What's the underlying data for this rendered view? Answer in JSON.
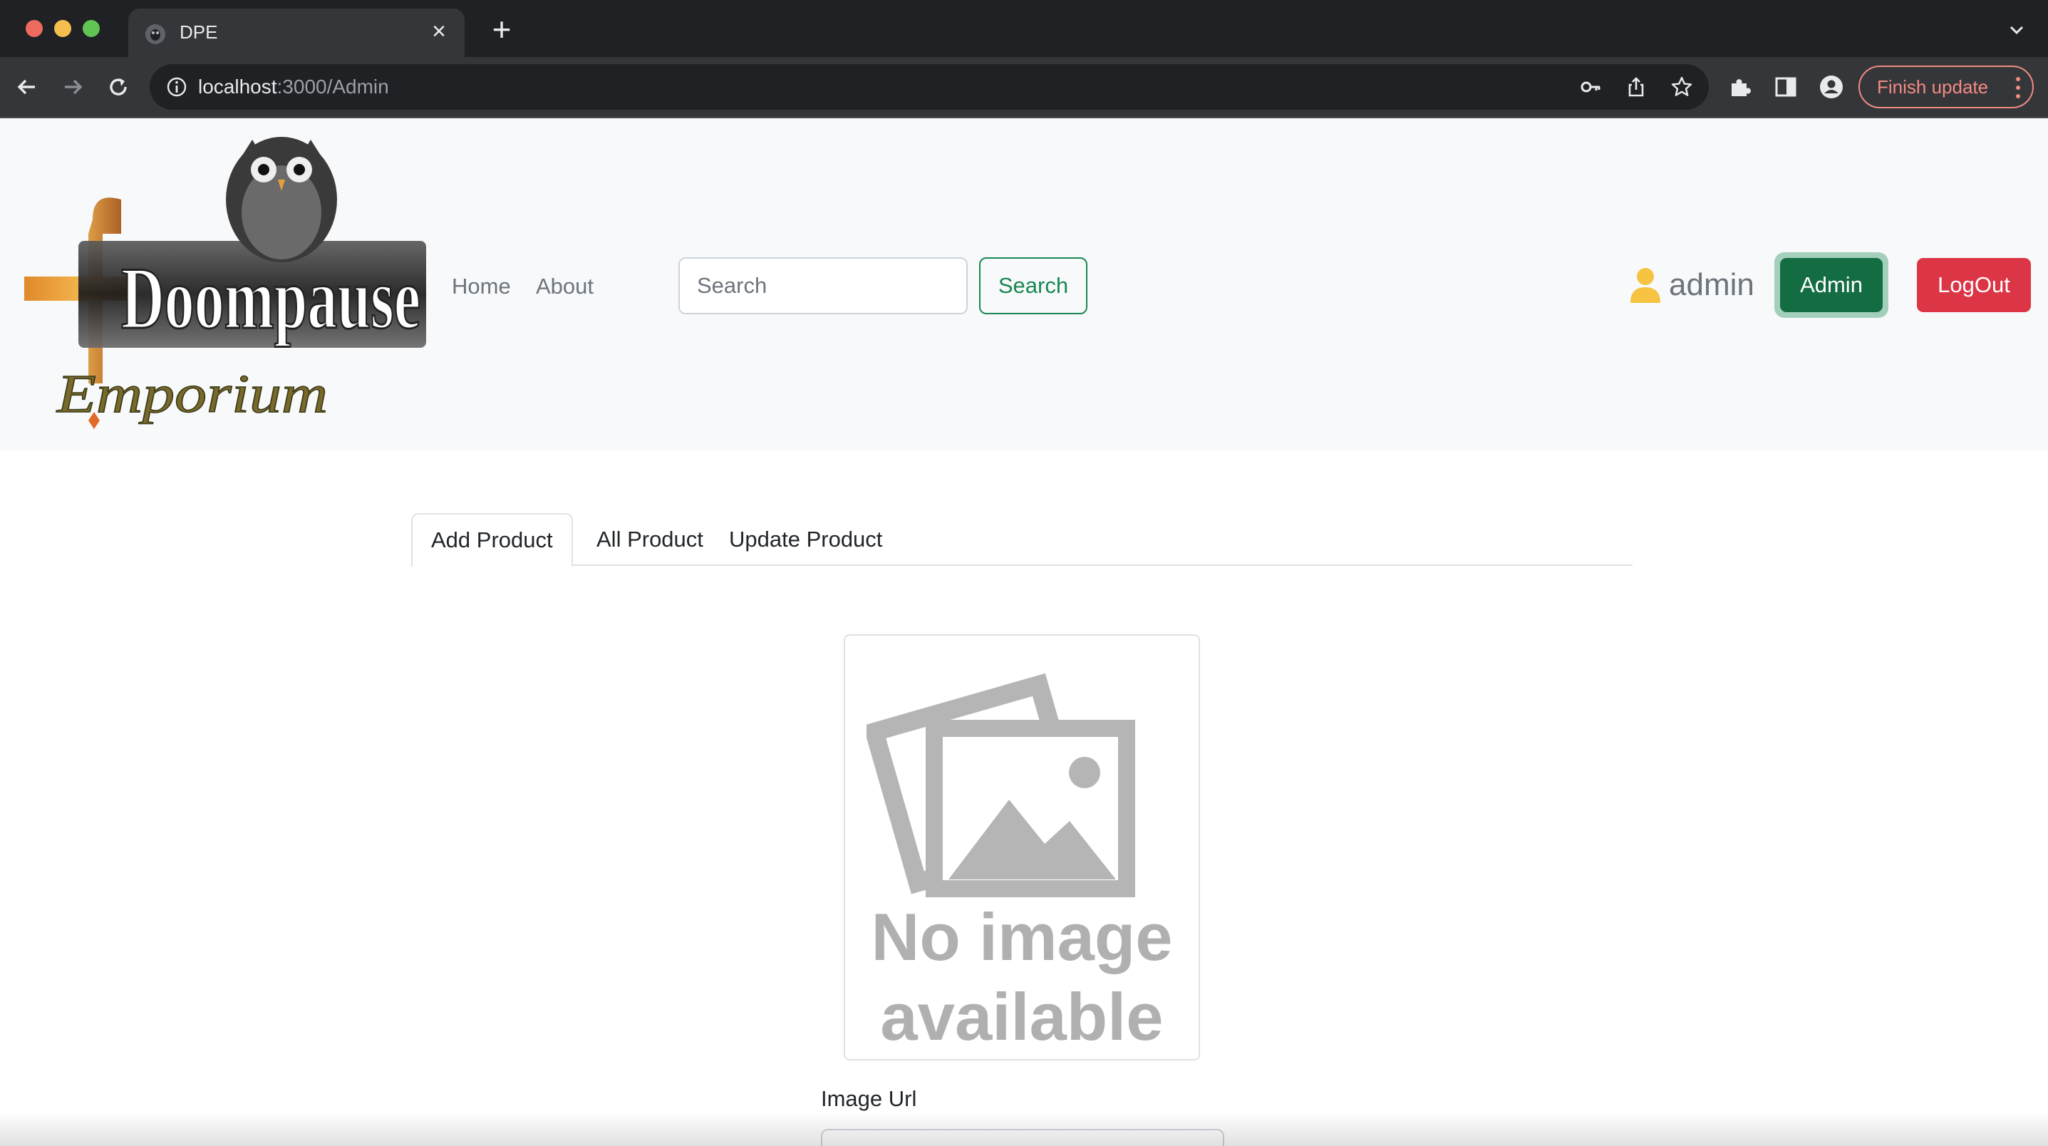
{
  "browser": {
    "tab_title": "DPE",
    "url_host": "localhost",
    "url_path": ":3000/Admin",
    "finish_update_label": "Finish update"
  },
  "navbar": {
    "brand_alt": "Doompause Emporium",
    "brand_line1": "Doompause",
    "brand_line2": "Emporium",
    "links": [
      {
        "label": "Home"
      },
      {
        "label": "About"
      }
    ],
    "search": {
      "placeholder": "Search",
      "button_label": "Search"
    },
    "user": {
      "icon": "person-icon",
      "name": "admin"
    },
    "admin_button_label": "Admin",
    "logout_button_label": "LogOut"
  },
  "tabs": [
    {
      "label": "Add Product",
      "active": true
    },
    {
      "label": "All Product",
      "active": false
    },
    {
      "label": "Update Product",
      "active": false
    }
  ],
  "product_form": {
    "image_placeholder_line1": "No image",
    "image_placeholder_line2": "available",
    "image_url_label": "Image Url"
  },
  "colors": {
    "success": "#198754",
    "danger": "#dc3545",
    "user_icon": "#f6c343"
  }
}
